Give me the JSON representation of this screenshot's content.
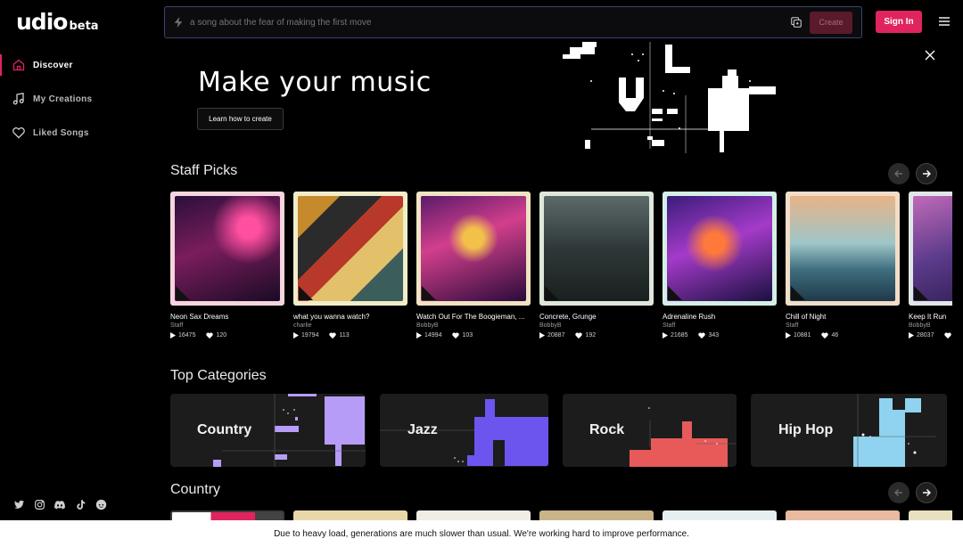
{
  "logo": {
    "main": "udio",
    "beta": "beta"
  },
  "sidebar": {
    "items": [
      {
        "label": "Discover",
        "icon": "home-icon",
        "active": true
      },
      {
        "label": "My Creations",
        "icon": "music-note-icon",
        "active": false
      },
      {
        "label": "Liked Songs",
        "icon": "heart-icon",
        "active": false
      }
    ],
    "socials": [
      "twitter-icon",
      "instagram-icon",
      "discord-icon",
      "tiktok-icon",
      "reddit-icon"
    ]
  },
  "search": {
    "placeholder": "a song about the fear of making the first move",
    "create_label": "Create"
  },
  "header": {
    "signin_label": "Sign In"
  },
  "hero": {
    "title": "Make your music",
    "button_label": "Learn how to create"
  },
  "staff_picks": {
    "title": "Staff Picks",
    "cards": [
      {
        "title": "Neon Sax Dreams",
        "artist": "Staff",
        "plays": "16475",
        "likes": "120",
        "frame": "#f4d6de"
      },
      {
        "title": "what you wanna watch?",
        "artist": "charlie",
        "plays": "19794",
        "likes": "113",
        "frame": "#f1ecc9"
      },
      {
        "title": "Watch Out For The Boogieman, ...",
        "artist": "BobbyB",
        "plays": "14994",
        "likes": "103",
        "frame": "#efe3c4"
      },
      {
        "title": "Concrete, Grunge",
        "artist": "BobbyB",
        "plays": "20887",
        "likes": "192",
        "frame": "#dfe7da"
      },
      {
        "title": "Adrenaline Rush",
        "artist": "Staff",
        "plays": "21685",
        "likes": "343",
        "frame": "#d4efe6"
      },
      {
        "title": "Chill of Night",
        "artist": "Staff",
        "plays": "10881",
        "likes": "46",
        "frame": "#f1ddc8"
      },
      {
        "title": "Keep It Run",
        "artist": "BobbyB",
        "plays": "28037",
        "likes": "",
        "frame": "#dfe7e8"
      }
    ]
  },
  "top_categories": {
    "title": "Top Categories",
    "items": [
      {
        "label": "Country",
        "color": "#b69cf6"
      },
      {
        "label": "Jazz",
        "color": "#6c55ee"
      },
      {
        "label": "Rock",
        "color": "#e85a5a"
      },
      {
        "label": "Hip Hop",
        "color": "#8fd3f0"
      }
    ]
  },
  "country": {
    "title": "Country"
  },
  "notice": "Due to heavy load, generations are much slower than usual. We're working hard to improve performance.",
  "colors": {
    "accent": "#e0245e",
    "background": "#000000",
    "card_bg": "#1c1c1c"
  }
}
